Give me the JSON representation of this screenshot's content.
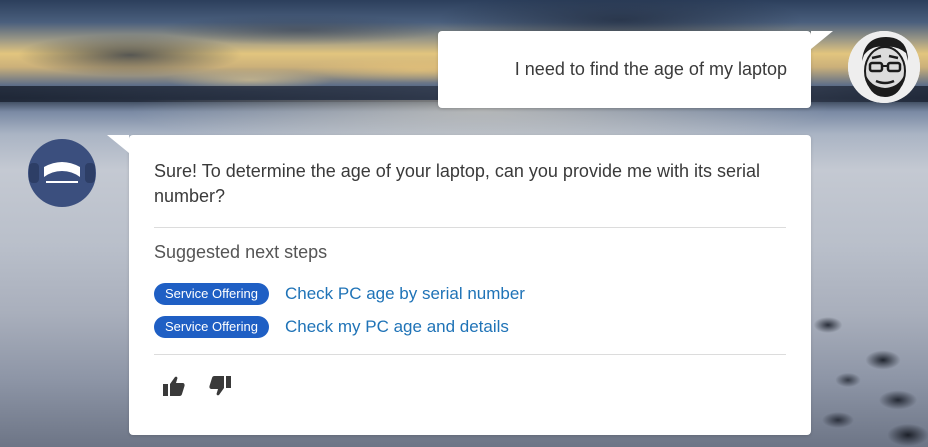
{
  "user": {
    "message": "I need to find the age of my laptop"
  },
  "bot": {
    "message": "Sure! To determine the age of your laptop, can you provide me with its serial number?",
    "suggested_title": "Suggested next steps",
    "suggestions": [
      {
        "badge": "Service Offering",
        "label": "Check PC age by serial number"
      },
      {
        "badge": "Service Offering",
        "label": "Check my PC age and details"
      }
    ]
  },
  "icons": {
    "thumbs_up": "thumbs-up-icon",
    "thumbs_down": "thumbs-down-icon",
    "bot_avatar": "bot-avatar-icon",
    "user_avatar": "user-avatar"
  },
  "colors": {
    "badge_bg": "#1f5fc4",
    "link": "#1f73b7",
    "bot_avatar": "#3b4f7e"
  }
}
